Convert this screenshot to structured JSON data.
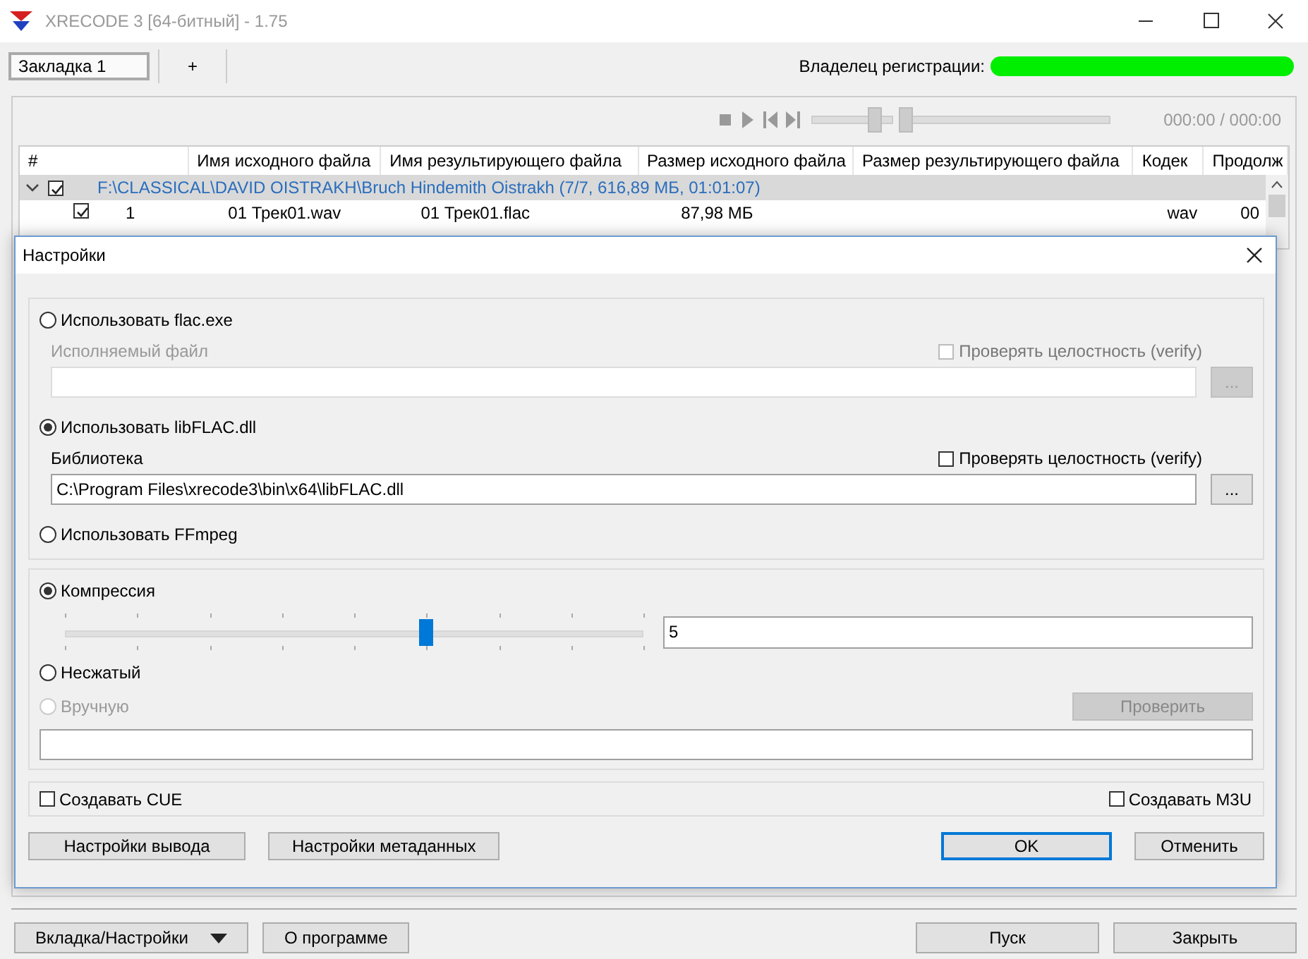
{
  "window": {
    "title": "XRECODE 3 [64-битный] - 1.75"
  },
  "tabs": [
    {
      "label": "Закладка 1",
      "selected": true
    },
    {
      "label": "+",
      "selected": false
    }
  ],
  "registration": {
    "label": "Владелец регистрации:",
    "redacted": true
  },
  "player": {
    "time": "000:00 / 000:00",
    "volume": {
      "level": 0.8
    },
    "position": {
      "level": 0
    }
  },
  "table": {
    "columns": [
      "#",
      "Имя исходного файла",
      "Имя результирующего файла",
      "Размер исходного файла",
      "Размер результирующего файла",
      "Кодек",
      "Продолж"
    ],
    "groups": [
      {
        "path": "F:\\CLASSICAL\\DAVID OISTRAKH\\Bruch Hindemith Oistrakh (7/7, 616,89 МБ, 01:01:07)",
        "expanded": true,
        "checked": true,
        "rows": [
          {
            "checked": true,
            "cells": [
              "1",
              "01 Трек01.wav",
              "01 Трек01.flac",
              "87,98 МБ",
              "",
              "wav",
              "00"
            ]
          }
        ]
      }
    ]
  },
  "dialog": {
    "title": "Настройки",
    "encoders": [
      {
        "kind": "path",
        "label": "Использовать flac.exe",
        "selected": false,
        "disabled": true,
        "field": {
          "label": "Исполняемый файл"
        },
        "verify": {
          "label": "Проверять целостность (verify)",
          "checked": false
        },
        "browse": "..."
      },
      {
        "kind": "path",
        "label": "Использовать libFLAC.dll",
        "selected": true,
        "disabled": false,
        "field": {
          "label": "Библиотека",
          "value": "C:\\Program Files\\xrecode3\\bin\\x64\\libFLAC.dll"
        },
        "verify": {
          "label": "Проверять целостность (verify)",
          "checked": false
        },
        "browse": "..."
      },
      {
        "kind": "plain",
        "label": "Использовать FFmpeg",
        "selected": false
      }
    ],
    "compression": {
      "label": "Компрессия",
      "selected": true,
      "level": 0.625,
      "value": "5"
    },
    "uncompressed": {
      "label": "Несжатый",
      "selected": false
    },
    "manual": {
      "label": "Вручную",
      "selected": false,
      "disabled": true,
      "button": "Проверить"
    },
    "options": [
      {
        "label": "Создавать CUE",
        "checked": false
      },
      {
        "label": "Создавать M3U",
        "checked": false
      }
    ],
    "buttons_left": [
      {
        "label": "Настройки вывода",
        "default": false
      },
      {
        "label": "Настройки метаданных",
        "default": false
      }
    ],
    "buttons_right": [
      {
        "label": "OK",
        "default": true
      },
      {
        "label": "Отменить",
        "default": false
      }
    ]
  },
  "bottom_left": [
    {
      "label": "Вкладка/Настройки",
      "kind": "menu"
    },
    {
      "label": "О программе",
      "kind": "plain"
    }
  ],
  "bottom_right": [
    {
      "label": "Пуск",
      "kind": "plain"
    },
    {
      "label": "Закрыть",
      "kind": "plain"
    }
  ]
}
